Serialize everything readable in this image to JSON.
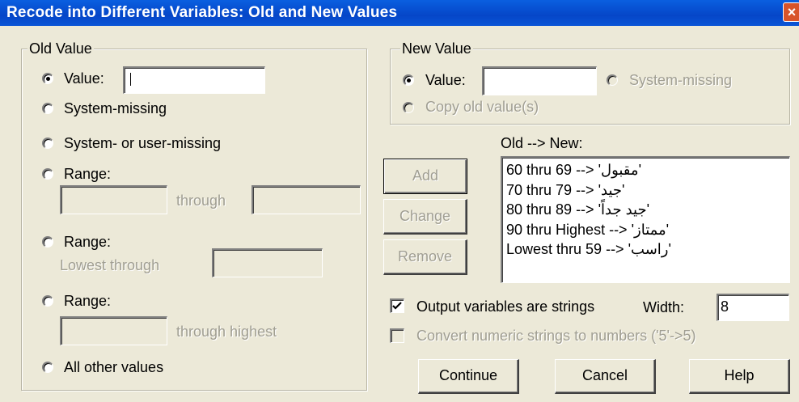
{
  "window": {
    "title": "Recode into Different Variables: Old and New Values",
    "close_glyph": "×"
  },
  "old_value": {
    "legend": "Old Value",
    "value_label": "Value:",
    "value_input": "",
    "system_missing": "System-missing",
    "system_user_missing": "System- or user-missing",
    "range1_label": "Range:",
    "through": "through",
    "range2_label": "Range:",
    "lowest_through": "Lowest through",
    "range3_label": "Range:",
    "through_highest": "through highest",
    "all_other": "All other values"
  },
  "new_value": {
    "legend": "New Value",
    "value_label": "Value:",
    "value_input": "",
    "system_missing": "System-missing",
    "copy_old": "Copy old value(s)"
  },
  "mapping": {
    "header": "Old --> New:",
    "items": [
      "60 thru 69 --> 'مقبول'",
      "70 thru 79 --> 'جيد'",
      "80 thru 89 --> 'جيد جداً'",
      "90 thru Highest --> 'ممتاز'",
      "Lowest thru 59 --> 'راسب'"
    ],
    "add": "Add",
    "change": "Change",
    "remove": "Remove"
  },
  "options": {
    "output_strings": "Output variables are strings",
    "width_label": "Width:",
    "width_value": "8",
    "convert_numeric": "Convert numeric strings to numbers ('5'->5)"
  },
  "buttons": {
    "continue": "Continue",
    "cancel": "Cancel",
    "help": "Help"
  }
}
